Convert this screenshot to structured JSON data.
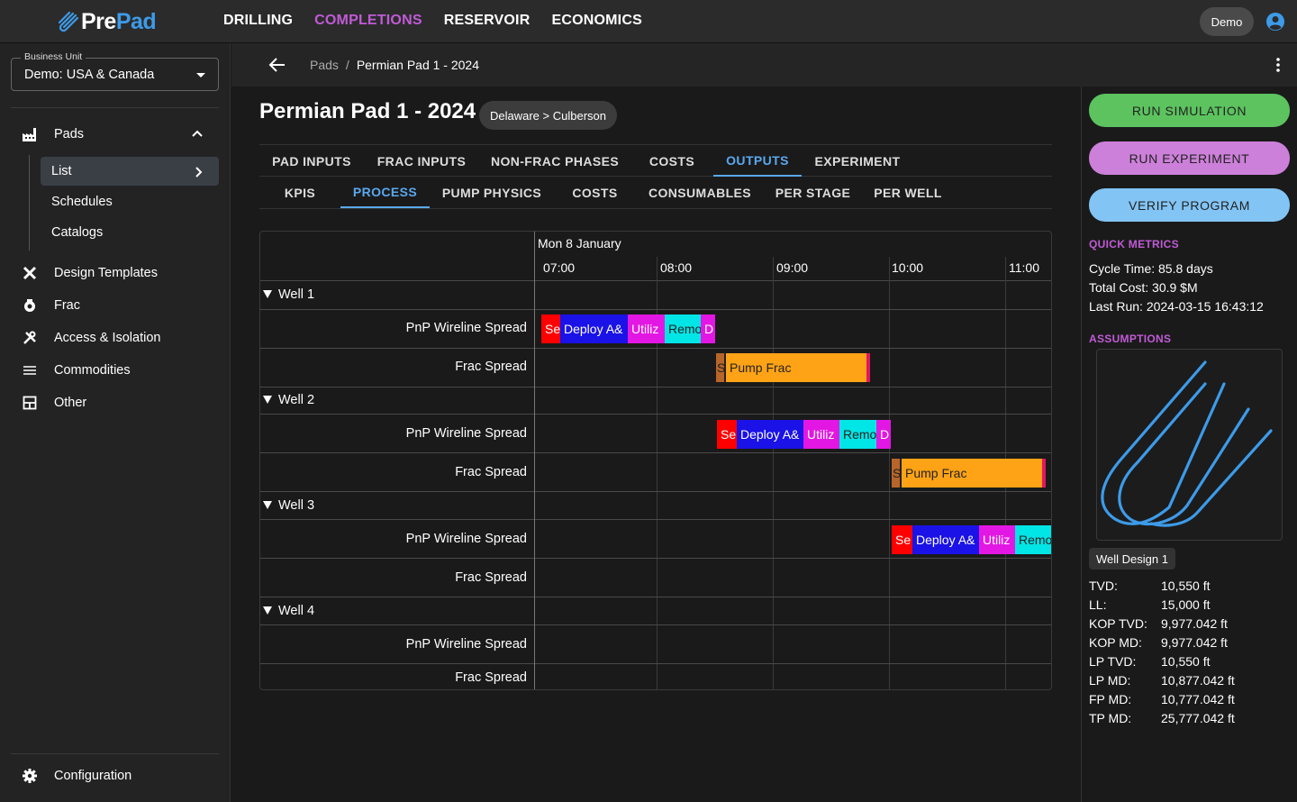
{
  "brand": {
    "pre": "Pre",
    "pad": "Pad"
  },
  "nav": [
    "DRILLING",
    "COMPLETIONS",
    "RESERVOIR",
    "ECONOMICS"
  ],
  "user": {
    "chip": "Demo"
  },
  "sidebar": {
    "business_unit_label": "Business Unit",
    "business_unit_value": "Demo: USA & Canada",
    "pads_label": "Pads",
    "sub_items": [
      "List",
      "Schedules",
      "Catalogs"
    ],
    "items": [
      "Design Templates",
      "Frac",
      "Access & Isolation",
      "Commodities",
      "Other"
    ],
    "configuration": "Configuration"
  },
  "breadcrumb": {
    "parent": "Pads",
    "separator": "/",
    "current": "Permian Pad 1 - 2024"
  },
  "page": {
    "title": "Permian Pad 1 - 2024",
    "location": "Delaware > Culberson"
  },
  "tabs": [
    "PAD INPUTS",
    "FRAC INPUTS",
    "NON-FRAC PHASES",
    "COSTS",
    "OUTPUTS",
    "EXPERIMENT"
  ],
  "subtabs": [
    "KPIS",
    "PROCESS",
    "PUMP PHYSICS",
    "COSTS",
    "CONSUMABLES",
    "PER STAGE",
    "PER WELL"
  ],
  "gantt": {
    "date": "Mon 8 January",
    "hours": [
      "07:00",
      "08:00",
      "09:00",
      "10:00",
      "11:00"
    ],
    "wells": [
      {
        "name": "Well 1",
        "rows": [
          "PnP Wireline Spread",
          "Frac Spread"
        ]
      },
      {
        "name": "Well 2",
        "rows": [
          "PnP Wireline Spread",
          "Frac Spread"
        ]
      },
      {
        "name": "Well 3",
        "rows": [
          "PnP Wireline Spread",
          "Frac Spread"
        ]
      },
      {
        "name": "Well 4",
        "rows": [
          "PnP Wireline Spread",
          "Frac Spread"
        ]
      }
    ],
    "bar_labels": {
      "se": "Se",
      "deploy": "Deploy A&",
      "utiliz": "Utiliz",
      "remo": "Remo",
      "d": "D",
      "s": "S",
      "pump": "Pump Frac"
    },
    "colors": {
      "red": "#ff0000",
      "blue": "#1a12e6",
      "magenta": "#e317e3",
      "cyan": "#00e5e5",
      "orange": "#ffa316",
      "brown": "#b8652a",
      "accent": "#e3175e"
    }
  },
  "right": {
    "run_simulation": "RUN SIMULATION",
    "run_experiment": "RUN EXPERIMENT",
    "verify_program": "VERIFY PROGRAM",
    "quick_metrics_title": "QUICK METRICS",
    "cycle_time": "Cycle Time: 85.8 days",
    "total_cost": "Total Cost: 30.9 $M",
    "last_run": "Last Run: 2024-03-15 16:43:12",
    "assumptions_title": "ASSUMPTIONS",
    "well_design": "Well Design 1",
    "kv": [
      {
        "k": "TVD:",
        "v": "10,550 ft"
      },
      {
        "k": "LL:",
        "v": "15,000 ft"
      },
      {
        "k": "KOP TVD:",
        "v": "9,977.042 ft"
      },
      {
        "k": "KOP MD:",
        "v": "9,977.042 ft"
      },
      {
        "k": "LP TVD:",
        "v": "10,550 ft"
      },
      {
        "k": "LP MD:",
        "v": "10,877.042 ft"
      },
      {
        "k": "FP MD:",
        "v": "10,777.042 ft"
      },
      {
        "k": "TP MD:",
        "v": "25,777.042 ft"
      }
    ]
  },
  "theme": {
    "green": "#5cc35f",
    "purple": "#cc80d9",
    "blue": "#82c4f4",
    "accent_blue": "#5aa8ee",
    "accent_purple": "#c05bd6"
  }
}
